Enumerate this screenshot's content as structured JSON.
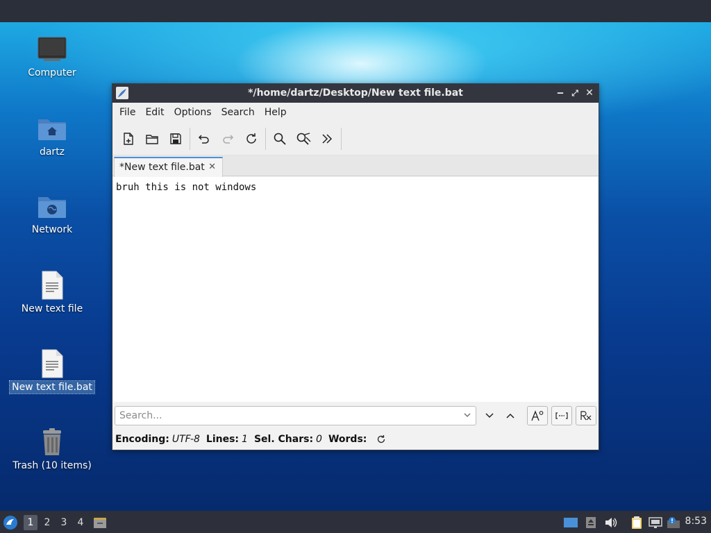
{
  "desktop": {
    "icons": [
      {
        "label": "Computer"
      },
      {
        "label": "dartz"
      },
      {
        "label": "Network"
      },
      {
        "label": "New text file"
      },
      {
        "label": "New text file.bat"
      },
      {
        "label": "Trash (10 items)"
      }
    ]
  },
  "window": {
    "title": "*/home/dartz/Desktop/New text file.bat",
    "controls": {
      "minimize": "‒",
      "maximize": "⤢",
      "close": "✕"
    }
  },
  "menubar": {
    "items": [
      "File",
      "Edit",
      "Options",
      "Search",
      "Help"
    ]
  },
  "toolbar": {
    "buttons": [
      "new-file",
      "open-file",
      "save",
      "undo",
      "redo",
      "reload",
      "find",
      "find-replace",
      "go-to-line"
    ]
  },
  "tabs": [
    {
      "label": "*New text file.bat",
      "close": "✕"
    }
  ],
  "editor": {
    "content": "bruh this is not windows"
  },
  "search": {
    "placeholder": "Search...",
    "value": ""
  },
  "statusbar": {
    "encoding_label": "Encoding:",
    "encoding_value": "UTF-8",
    "lines_label": "Lines:",
    "lines_value": "1",
    "selchars_label": "Sel. Chars:",
    "selchars_value": "0",
    "words_label": "Words:"
  },
  "taskbar": {
    "workspaces": [
      "1",
      "2",
      "3",
      "4"
    ],
    "clock": "8:53"
  },
  "colors": {
    "accent": "#4a90d9",
    "titlebar": "#33363f",
    "taskbar": "#2d303a",
    "selection": "#3465a4"
  }
}
